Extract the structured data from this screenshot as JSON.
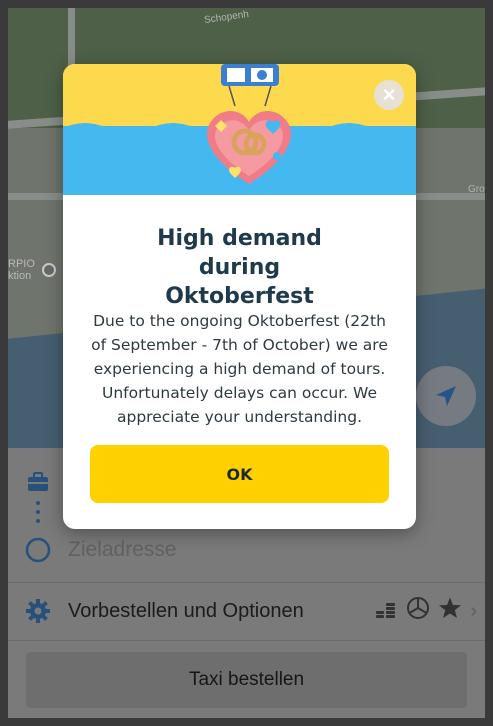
{
  "map": {
    "street_label": "Schopenh",
    "street_label_right": "Gro",
    "poi_label_line1": "RPIO",
    "poi_label_line2": "ktion"
  },
  "panel": {
    "destination_placeholder": "Zieladresse",
    "options_label": "Vorbestellen und Optionen",
    "order_button_label": "Taxi bestellen"
  },
  "modal": {
    "title": "High demand during Oktoberfest",
    "message": "Due to the ongoing Oktoberfest (22th of September - 7th of October) we are experiencing a high demand of tours. Unfortunately delays can occur. We appreciate your understanding.",
    "ok_label": "OK",
    "close_glyph": "×"
  },
  "colors": {
    "header_yellow": "#fdd94e",
    "header_blue": "#45b9ef",
    "ok_yellow": "#ffd100",
    "title_navy": "#1f3a4b"
  }
}
